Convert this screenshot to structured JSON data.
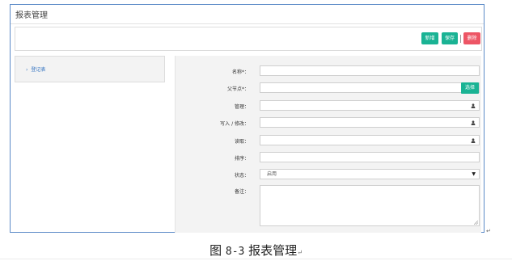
{
  "page": {
    "title": "报表管理"
  },
  "toolbar": {
    "new_label": "新增",
    "save_label": "保存",
    "delete_label": "删除"
  },
  "tree": {
    "items": [
      {
        "label": "登记表"
      }
    ]
  },
  "form": {
    "name_label": "名称*：",
    "parent_label": "父节点*：",
    "parent_button": "选择",
    "manage_label": "管理：",
    "write_label": "写入 / 修改：",
    "read_label": "读取：",
    "order_label": "排序：",
    "status_label": "状态：",
    "status_value": "启用",
    "remark_label": "备注："
  },
  "caption": {
    "prefix": "图",
    "number": "8-3",
    "text": "报表管理"
  },
  "colors": {
    "accent_green": "#1ab394",
    "danger_red": "#ed5565",
    "link_blue": "#3574c1",
    "frame_border": "#5b8ac7"
  },
  "icons": {
    "field_icon": "user-icon",
    "tree_icon": "chevron-right-icon"
  }
}
